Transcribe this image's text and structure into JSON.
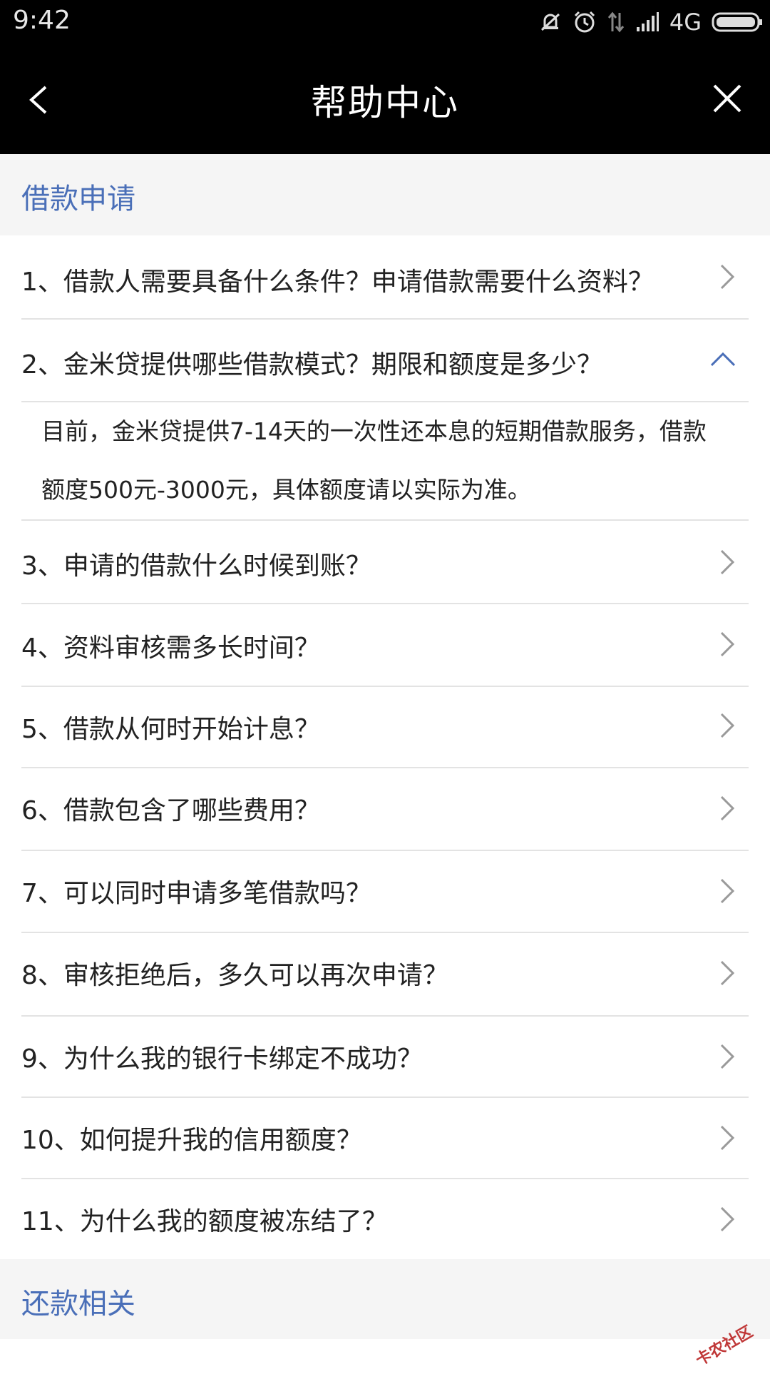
{
  "status": {
    "time": "9:42",
    "network": "4G",
    "icons": [
      "mute-icon",
      "alarm-icon",
      "data-arrows-icon",
      "signal-icon",
      "battery-icon"
    ]
  },
  "nav": {
    "title": "帮助中心",
    "back_icon": "chevron-left-icon",
    "close_icon": "close-icon"
  },
  "sections": [
    {
      "title": "借款申请"
    },
    {
      "title": "还款相关"
    }
  ],
  "faq": [
    {
      "q": "1、借款人需要具备什么条件？申请借款需要什么资料？",
      "expanded": false
    },
    {
      "q": "2、金米贷提供哪些借款模式？期限和额度是多少？",
      "expanded": true,
      "answer_line1": "目前，金米贷提供7-14天的一次性还本息的短期借款服务，借款",
      "answer_line2": "额度500元-3000元，具体额度请以实际为准。"
    },
    {
      "q": "3、申请的借款什么时候到账？",
      "expanded": false
    },
    {
      "q": "4、资料审核需多长时间？",
      "expanded": false
    },
    {
      "q": "5、借款从何时开始计息？",
      "expanded": false
    },
    {
      "q": "6、借款包含了哪些费用？",
      "expanded": false
    },
    {
      "q": "7、可以同时申请多笔借款吗？",
      "expanded": false
    },
    {
      "q": "8、审核拒绝后，多久可以再次申请？",
      "expanded": false
    },
    {
      "q": "9、为什么我的银行卡绑定不成功？",
      "expanded": false
    },
    {
      "q": "10、如何提升我的信用额度？",
      "expanded": false
    },
    {
      "q": "11、为什么我的额度被冻结了？",
      "expanded": false
    }
  ],
  "watermark": "卡农社区",
  "colors": {
    "accent": "#4a6fb8",
    "nav_bg": "#000000",
    "section_bg": "#f5f5f5",
    "text": "#222222",
    "chevron": "#9a9a9a"
  }
}
